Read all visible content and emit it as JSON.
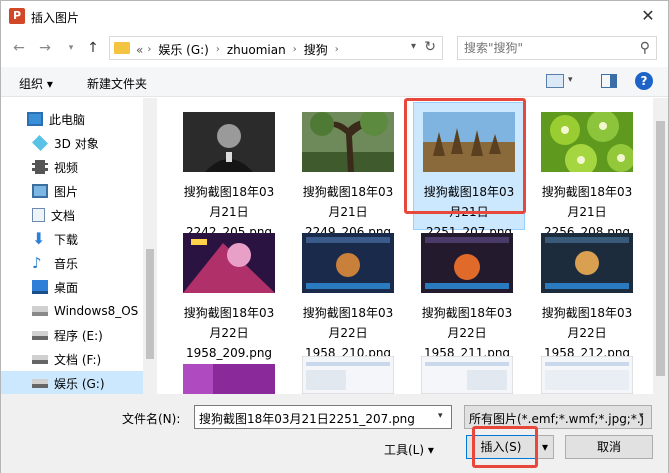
{
  "window": {
    "title": "插入图片",
    "app_icon_letter": "P"
  },
  "navigation": {
    "breadcrumb": [
      "«",
      "娱乐 (G:)",
      "zhuomian",
      "搜狗"
    ],
    "search_placeholder": "搜索\"搜狗\""
  },
  "toolbar": {
    "organize_label": "组织 ▾",
    "new_folder_label": "新建文件夹",
    "help_label": "?"
  },
  "sidebar": {
    "items": [
      {
        "label": "此电脑",
        "icon": "computer-icon"
      },
      {
        "label": "3D 对象",
        "icon": "cube-icon"
      },
      {
        "label": "视频",
        "icon": "video-icon"
      },
      {
        "label": "图片",
        "icon": "pictures-icon"
      },
      {
        "label": "文档",
        "icon": "document-icon"
      },
      {
        "label": "下载",
        "icon": "download-icon"
      },
      {
        "label": "音乐",
        "icon": "music-icon"
      },
      {
        "label": "桌面",
        "icon": "desktop-icon"
      },
      {
        "label": "Windows8_OS",
        "icon": "drive-icon"
      },
      {
        "label": "程序 (E:)",
        "icon": "drive-icon"
      },
      {
        "label": "文档 (F:)",
        "icon": "drive-icon"
      },
      {
        "label": "娱乐 (G:)",
        "icon": "drive-icon",
        "selected": true
      }
    ]
  },
  "files": [
    {
      "line1": "搜狗截图18年03",
      "line2": "月21日",
      "line3": "2242_205.png",
      "thumb": "portrait-photo",
      "selected": false
    },
    {
      "line1": "搜狗截图18年03",
      "line2": "月21日",
      "line3": "2249_206.png",
      "thumb": "forest-photo",
      "selected": false
    },
    {
      "line1": "搜狗截图18年03",
      "line2": "月21日",
      "line3": "2251_207.png",
      "thumb": "field-photo",
      "selected": true
    },
    {
      "line1": "搜狗截图18年03",
      "line2": "月21日",
      "line3": "2256_208.png",
      "thumb": "kiwi-photo",
      "selected": false
    },
    {
      "line1": "搜狗截图18年03",
      "line2": "月22日",
      "line3": "1958_209.png",
      "thumb": "game-art",
      "selected": false
    },
    {
      "line1": "搜狗截图18年03",
      "line2": "月22日",
      "line3": "1958_210.png",
      "thumb": "game-screen",
      "selected": false
    },
    {
      "line1": "搜狗截图18年03",
      "line2": "月22日",
      "line3": "1958_211.png",
      "thumb": "game-screen",
      "selected": false
    },
    {
      "line1": "搜狗截图18年03",
      "line2": "月22日",
      "line3": "1958_212.png",
      "thumb": "game-screen",
      "selected": false
    }
  ],
  "bottom": {
    "filename_label": "文件名(N):",
    "filename_value": "搜狗截图18年03月21日2251_207.png",
    "filter_value": "所有图片(*.emf;*.wmf;*.jpg;*.j",
    "tools_label": "工具(L)  ▾",
    "insert_label": "插入(S)",
    "cancel_label": "取消"
  },
  "colors": {
    "selection": "#cce8ff",
    "annotation": "#e8473b",
    "accent": "#0078d7"
  }
}
